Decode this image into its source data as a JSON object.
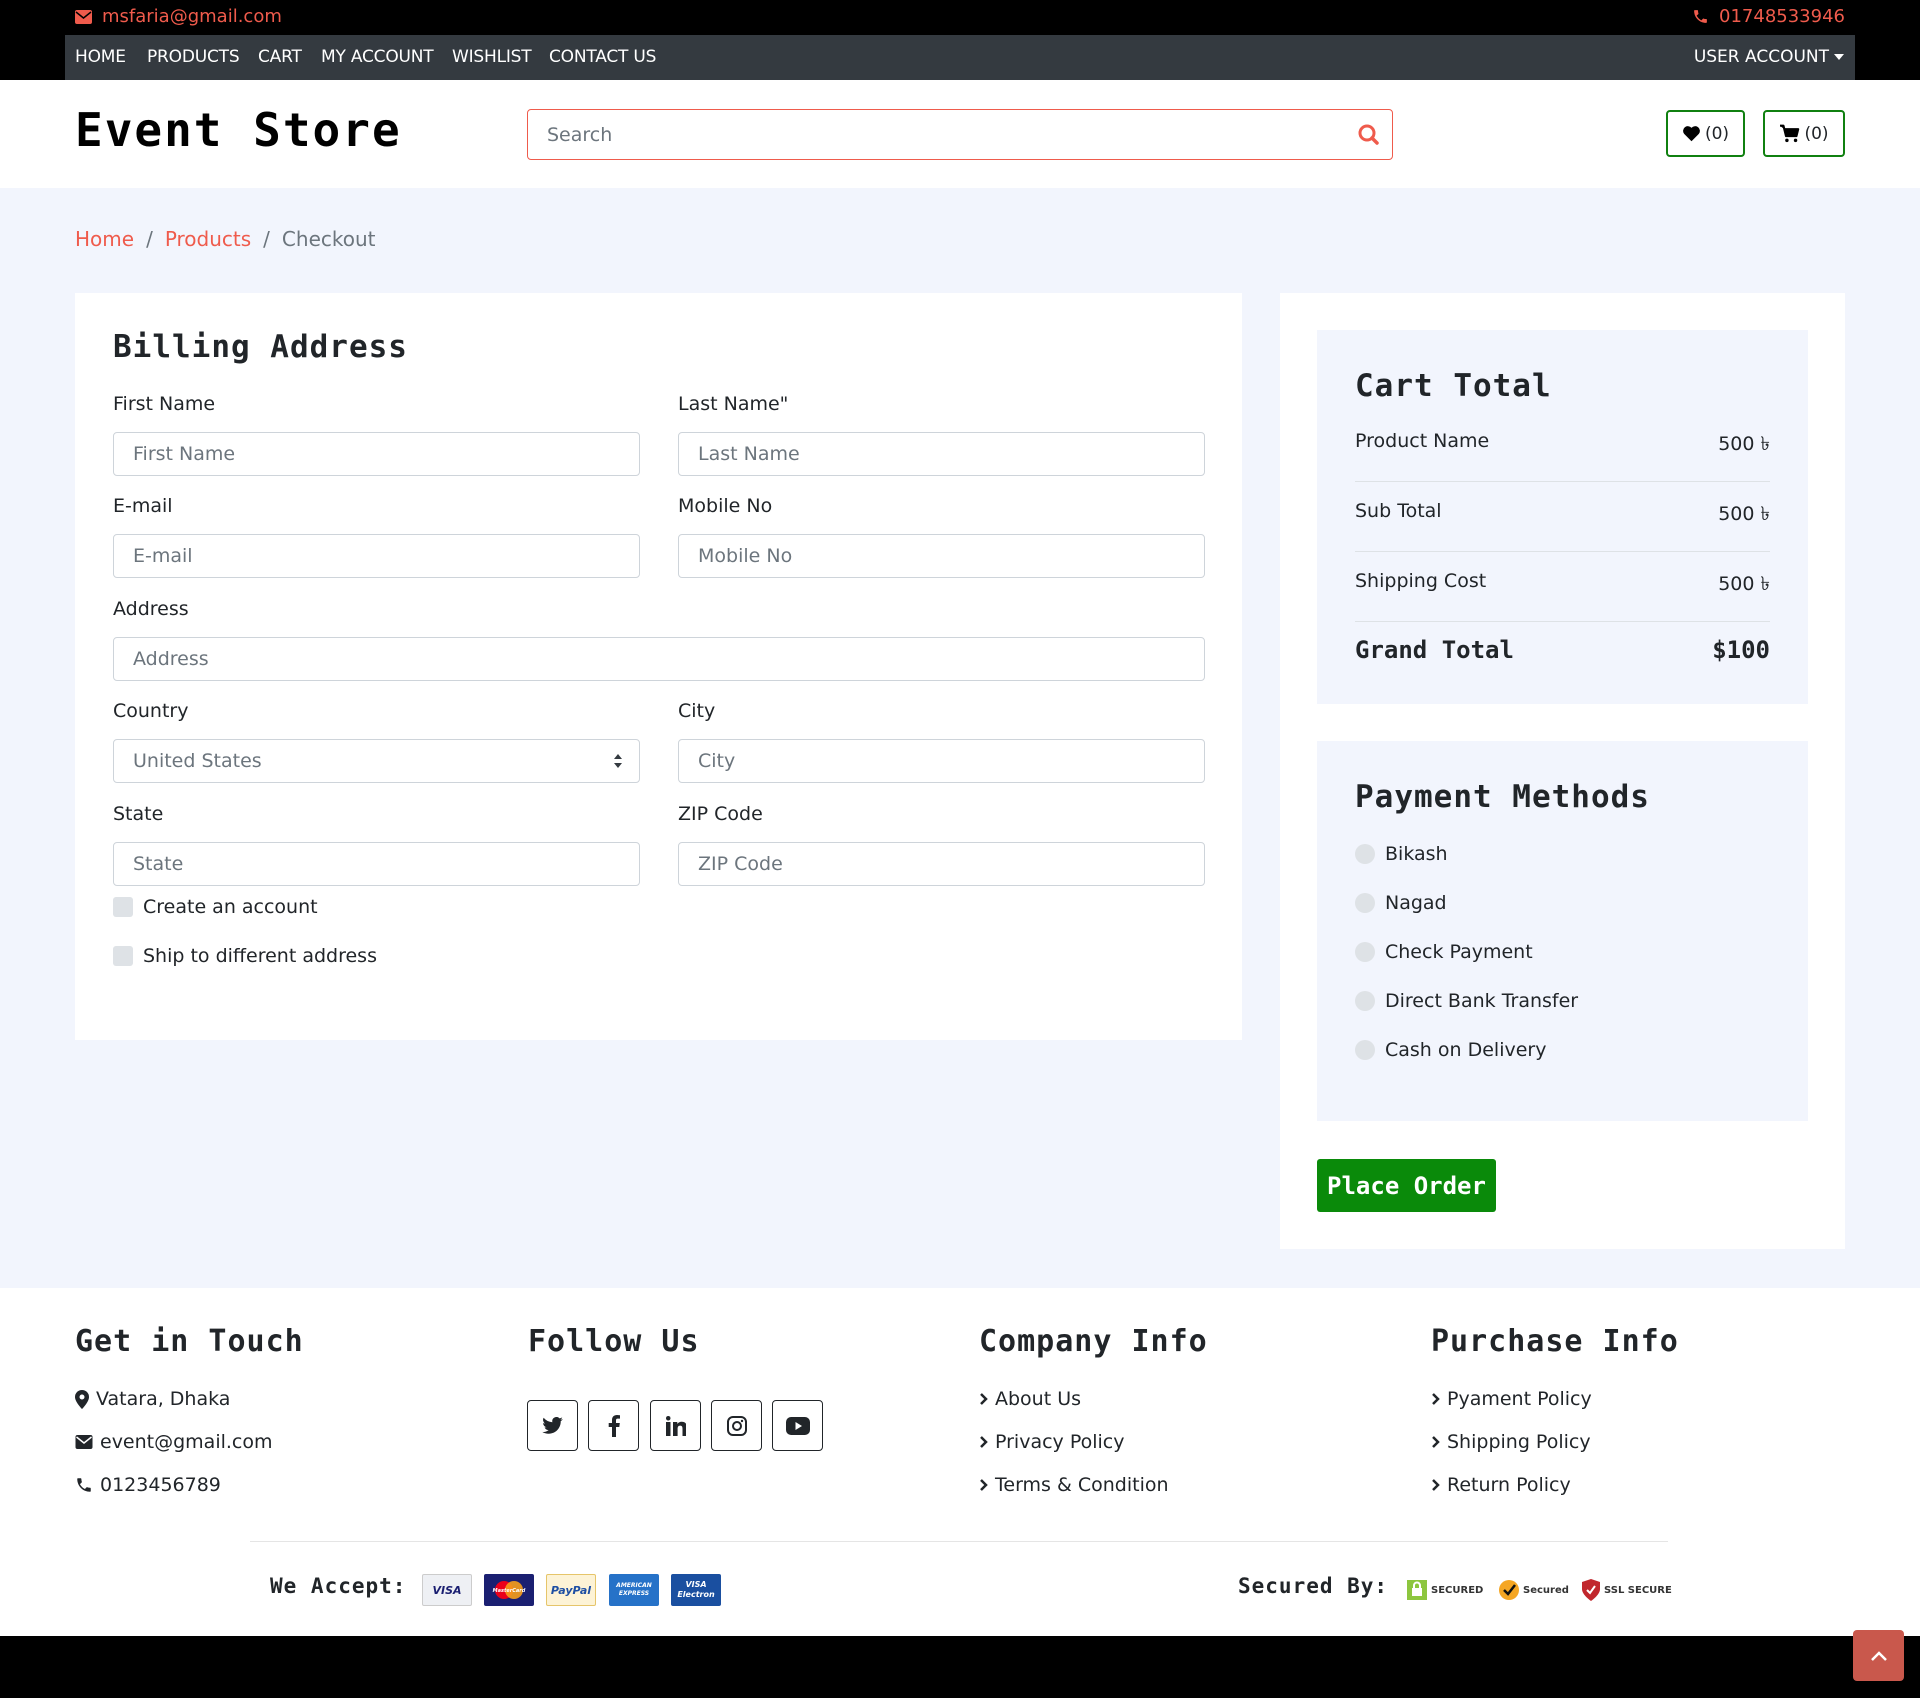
{
  "topbar": {
    "email": "msfaria@gmail.com",
    "phone": "01748533946",
    "accent": "#ef5b4c"
  },
  "nav": {
    "items": [
      {
        "label": "HOME"
      },
      {
        "label": "PRODUCTS"
      },
      {
        "label": "CART"
      },
      {
        "label": "MY ACCOUNT"
      },
      {
        "label": "WISHLIST"
      },
      {
        "label": "CONTACT US"
      }
    ],
    "user_menu": "USER ACCOUNT"
  },
  "header": {
    "logo": "Event Store",
    "search_placeholder": "Search",
    "wishlist_count": "(0)",
    "cart_count": "(0)"
  },
  "breadcrumb": {
    "items": [
      "Home",
      "Products",
      "Checkout"
    ],
    "separator": "/"
  },
  "billing": {
    "title": "Billing Address",
    "first_name": {
      "label": "First Name",
      "placeholder": "First Name"
    },
    "last_name": {
      "label": "Last Name\"",
      "placeholder": "Last Name"
    },
    "email": {
      "label": "E-mail",
      "placeholder": "E-mail"
    },
    "mobile": {
      "label": "Mobile No",
      "placeholder": "Mobile No"
    },
    "address": {
      "label": "Address",
      "placeholder": "Address"
    },
    "country": {
      "label": "Country",
      "value": "United States"
    },
    "city": {
      "label": "City",
      "placeholder": "City"
    },
    "state": {
      "label": "State",
      "placeholder": "State"
    },
    "zip": {
      "label": "ZIP Code",
      "placeholder": "ZIP Code"
    },
    "create_account": "Create an account",
    "ship_different": "Ship to different address"
  },
  "cart_total": {
    "title": "Cart Total",
    "rows": [
      {
        "label": "Product Name",
        "value": "500 ৳"
      },
      {
        "label": "Sub Total",
        "value": "500 ৳"
      },
      {
        "label": "Shipping Cost",
        "value": "500 ৳"
      }
    ],
    "grand_label": "Grand Total",
    "grand_value": "$100"
  },
  "payment": {
    "title": "Payment Methods",
    "methods": [
      "Bikash",
      "Nagad",
      "Check Payment",
      "Direct Bank Transfer",
      "Cash on Delivery"
    ]
  },
  "place_order": "Place Order",
  "footer": {
    "touch": {
      "title": "Get in Touch",
      "location": "Vatara, Dhaka",
      "email": "event@gmail.com",
      "phone": "0123456789"
    },
    "follow": {
      "title": "Follow Us",
      "icons": [
        "twitter-icon",
        "facebook-icon",
        "linkedin-icon",
        "instagram-icon",
        "youtube-icon"
      ]
    },
    "company": {
      "title": "Company Info",
      "links": [
        "About Us",
        "Privacy Policy",
        "Terms & Condition"
      ]
    },
    "purchase": {
      "title": "Purchase Info",
      "links": [
        "Pyament Policy",
        "Shipping Policy",
        "Return Policy"
      ]
    },
    "we_accept": "We Accept:",
    "cards": [
      "VISA",
      "MasterCard",
      "PayPal",
      "AMERICAN EXPRESS",
      "VISA Electron"
    ],
    "secured_by": "Secured By:",
    "seals": [
      "SECURED",
      "Secured",
      "SSL SECURE"
    ]
  },
  "colors": {
    "accent": "#ef5b4c",
    "green": "#0a8a0a",
    "nav_bg": "#343a40",
    "page_bg": "#f2f5fd"
  }
}
